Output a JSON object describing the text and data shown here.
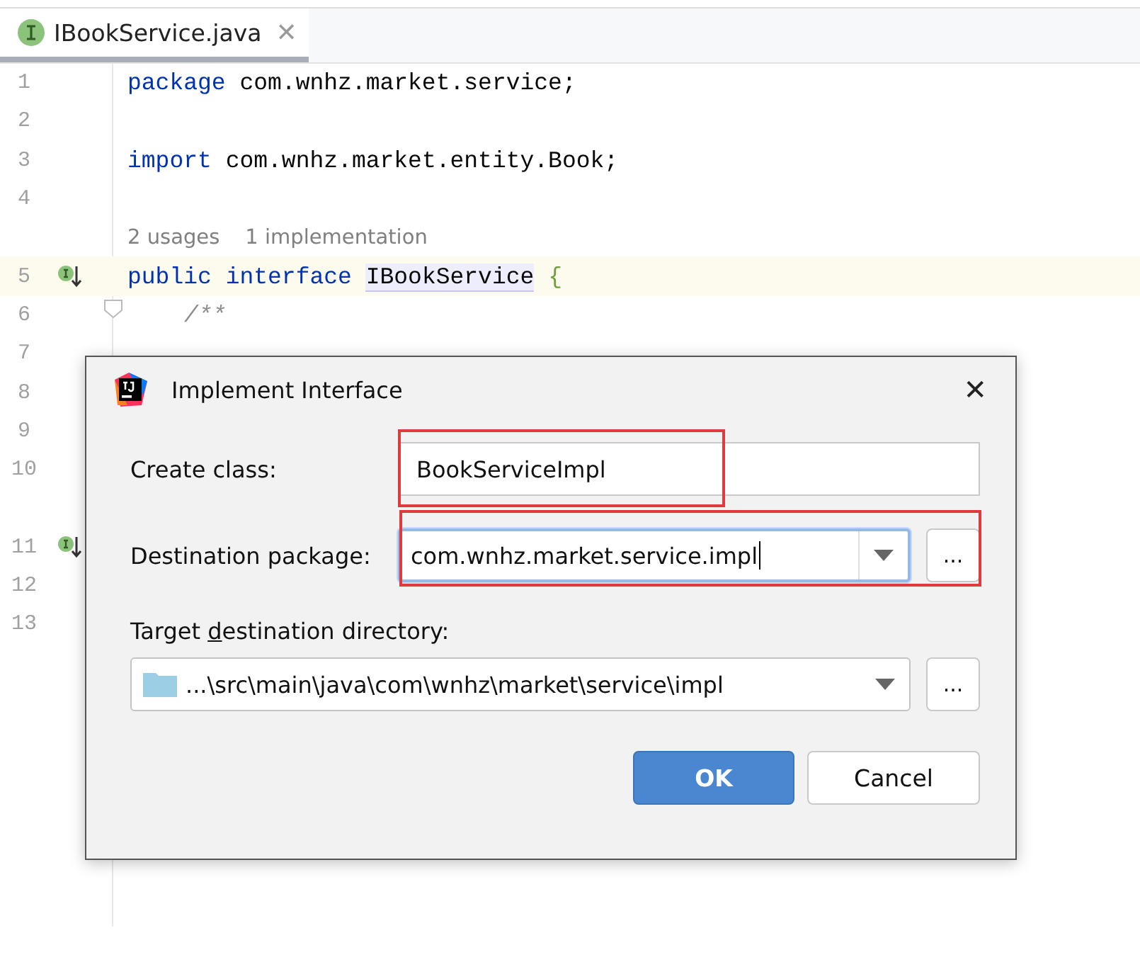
{
  "tabs": [
    {
      "label": "IBookService.java",
      "selected": true,
      "close": "✕"
    }
  ],
  "lines": [
    {
      "kind": "code",
      "number": "1",
      "parts": [
        {
          "kind": "keyword",
          "text": "package"
        },
        {
          "kind": "plain",
          "text": " com.wnhz.market.service;"
        }
      ]
    },
    {
      "kind": "code",
      "number": "2"
    },
    {
      "kind": "code",
      "number": "3",
      "parts": [
        {
          "kind": "keyword",
          "text": "import"
        },
        {
          "kind": "plain",
          "text": " com.wnhz.market.entity.Book;"
        }
      ]
    },
    {
      "kind": "code",
      "number": "4"
    },
    {
      "kind": "hint",
      "hints": [
        "2 usages",
        "1 implementation"
      ]
    },
    {
      "kind": "code",
      "number": "5",
      "current": true,
      "implemented": true,
      "parts": [
        {
          "kind": "keyword",
          "text": "public"
        },
        {
          "kind": "keyword",
          "text": " interface"
        },
        {
          "kind": "usage",
          "text": "IBookService"
        },
        {
          "kind": "brace",
          "text": " {"
        }
      ]
    },
    {
      "kind": "code",
      "number": "6",
      "foldable": true,
      "indented": true,
      "parts": [
        {
          "kind": "comment",
          "text": "/**"
        }
      ]
    },
    {
      "kind": "code",
      "number": "7"
    },
    {
      "kind": "code",
      "number": "8"
    },
    {
      "kind": "code",
      "number": "9"
    },
    {
      "kind": "code",
      "number": "10"
    },
    {
      "kind": "spacer"
    },
    {
      "kind": "code",
      "number": "11",
      "implemented": true
    },
    {
      "kind": "code",
      "number": "12"
    },
    {
      "kind": "code",
      "number": "13"
    }
  ],
  "dialog": {
    "title": "Implement Interface",
    "close": "✕",
    "create_class": {
      "label": "Create class:",
      "value": "BookServiceImpl",
      "highlighted": true
    },
    "destination_package": {
      "label": "Destination package:",
      "value": "com.wnhz.market.service.impl",
      "focused": true,
      "highlighted": true,
      "browse": "..."
    },
    "target_directory": {
      "label_parts": [
        {
          "text": "Target ",
          "mnemonic": false
        },
        {
          "text": "d",
          "mnemonic": true
        },
        {
          "text": "estination directory:",
          "mnemonic": false
        }
      ],
      "value": "...\\src\\main\\java\\com\\wnhz\\market\\service\\impl",
      "browse": "..."
    },
    "buttons": [
      {
        "label": "OK",
        "kind": "default"
      },
      {
        "label": "Cancel",
        "kind": "normal"
      }
    ]
  }
}
